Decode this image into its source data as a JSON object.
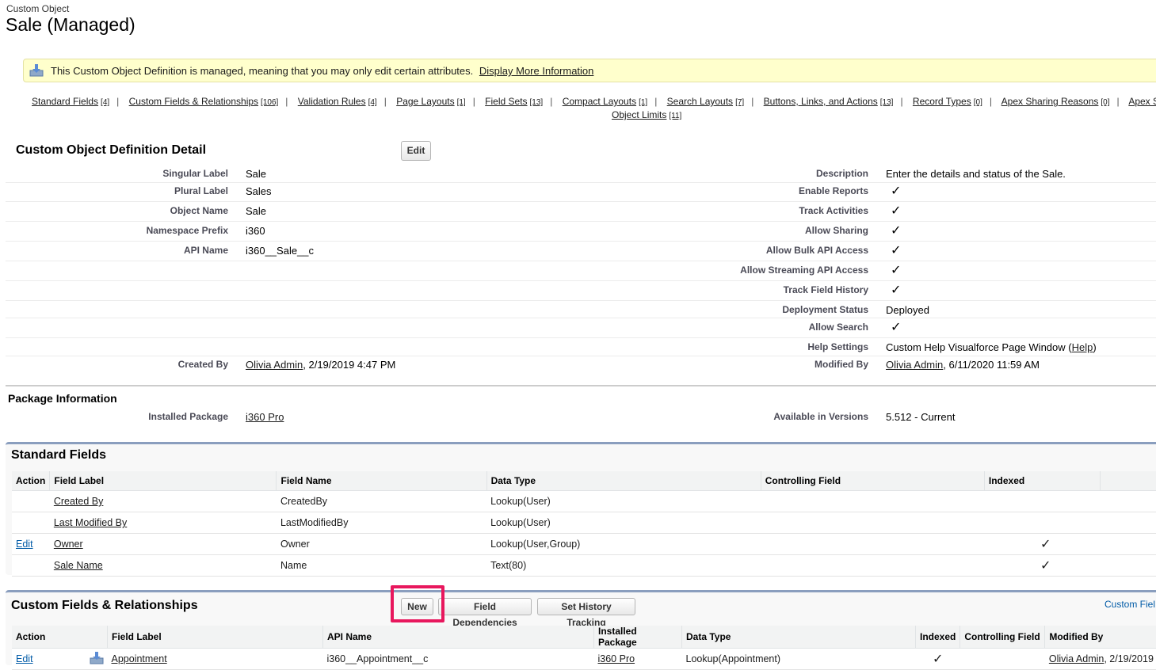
{
  "header": {
    "type_label": "Custom Object",
    "title": "Sale (Managed)"
  },
  "infobar": {
    "message": "This Custom Object Definition is managed, meaning that you may only edit certain attributes.",
    "link": "Display More Information"
  },
  "related_links": [
    {
      "label": "Standard Fields",
      "count": "[4]"
    },
    {
      "label": "Custom Fields & Relationships",
      "count": "[106]"
    },
    {
      "label": "Validation Rules",
      "count": "[4]"
    },
    {
      "label": "Page Layouts",
      "count": "[1]"
    },
    {
      "label": "Field Sets",
      "count": "[13]"
    },
    {
      "label": "Compact Layouts",
      "count": "[1]"
    },
    {
      "label": "Search Layouts",
      "count": "[7]"
    },
    {
      "label": "Buttons, Links, and Actions",
      "count": "[13]"
    },
    {
      "label": "Record Types",
      "count": "[0]"
    },
    {
      "label": "Apex Sharing Reasons",
      "count": "[0]"
    },
    {
      "label": "Apex S",
      "count": ""
    }
  ],
  "related_links_row2": {
    "label": "Object Limits",
    "count": "[11]"
  },
  "detail": {
    "title": "Custom Object Definition Detail",
    "edit_button": "Edit",
    "left": {
      "singular_label": {
        "label": "Singular Label",
        "value": "Sale"
      },
      "plural_label": {
        "label": "Plural Label",
        "value": "Sales"
      },
      "object_name": {
        "label": "Object Name",
        "value": "Sale"
      },
      "namespace_prefix": {
        "label": "Namespace Prefix",
        "value": "i360"
      },
      "api_name": {
        "label": "API Name",
        "value": "i360__Sale__c"
      },
      "created_by": {
        "label": "Created By",
        "user": "Olivia Admin",
        "date": ", 2/19/2019 4:47 PM"
      }
    },
    "right": {
      "description": {
        "label": "Description",
        "value": "Enter the details and status of the Sale."
      },
      "enable_reports": {
        "label": "Enable Reports"
      },
      "track_activities": {
        "label": "Track Activities"
      },
      "allow_sharing": {
        "label": "Allow Sharing"
      },
      "allow_bulk": {
        "label": "Allow Bulk API Access"
      },
      "allow_streaming": {
        "label": "Allow Streaming API Access"
      },
      "track_history": {
        "label": "Track Field History"
      },
      "deployment_status": {
        "label": "Deployment Status",
        "value": "Deployed"
      },
      "allow_search": {
        "label": "Allow Search"
      },
      "help_settings": {
        "label": "Help Settings",
        "value": "Custom Help Visualforce Page Window (",
        "link": "Help",
        "close": ")"
      },
      "modified_by": {
        "label": "Modified By",
        "user": "Olivia Admin",
        "date": ", 6/11/2020 11:59 AM"
      }
    },
    "check_glyph": "✓"
  },
  "package": {
    "title": "Package Information",
    "installed_label": "Installed Package",
    "installed_value": "i360 Pro",
    "versions_label": "Available in Versions",
    "versions_value": "5.512 - Current"
  },
  "standard_fields": {
    "title": "Standard Fields",
    "columns": [
      "Action",
      "Field Label",
      "Field Name",
      "Data Type",
      "Controlling Field",
      "Indexed"
    ],
    "rows": [
      {
        "action": "",
        "label": "Created By",
        "name": "CreatedBy",
        "type": "Lookup(User)",
        "indexed": ""
      },
      {
        "action": "",
        "label": "Last Modified By",
        "name": "LastModifiedBy",
        "type": "Lookup(User)",
        "indexed": ""
      },
      {
        "action": "Edit",
        "label": "Owner",
        "name": "Owner",
        "type": "Lookup(User,Group)",
        "indexed": "✓"
      },
      {
        "action": "",
        "label": "Sale Name",
        "name": "Name",
        "type": "Text(80)",
        "indexed": "✓"
      }
    ]
  },
  "custom_fields": {
    "title": "Custom Fields & Relationships",
    "new_button": "New",
    "deps_button": "Field Dependencies",
    "history_button": "Set History Tracking",
    "help_link": "Custom Fiel",
    "columns": [
      "Action",
      "Field Label",
      "API Name",
      "Installed Package",
      "Data Type",
      "Indexed",
      "Controlling Field",
      "Modified By"
    ],
    "rows": [
      {
        "action": "Edit",
        "label": "Appointment",
        "api": "i360__Appointment__c",
        "package": "i360 Pro",
        "type": "Lookup(Appointment)",
        "indexed": "✓",
        "controlling": "",
        "modified_user": "Olivia Admin",
        "modified_date": ", 2/19/2019"
      }
    ]
  }
}
